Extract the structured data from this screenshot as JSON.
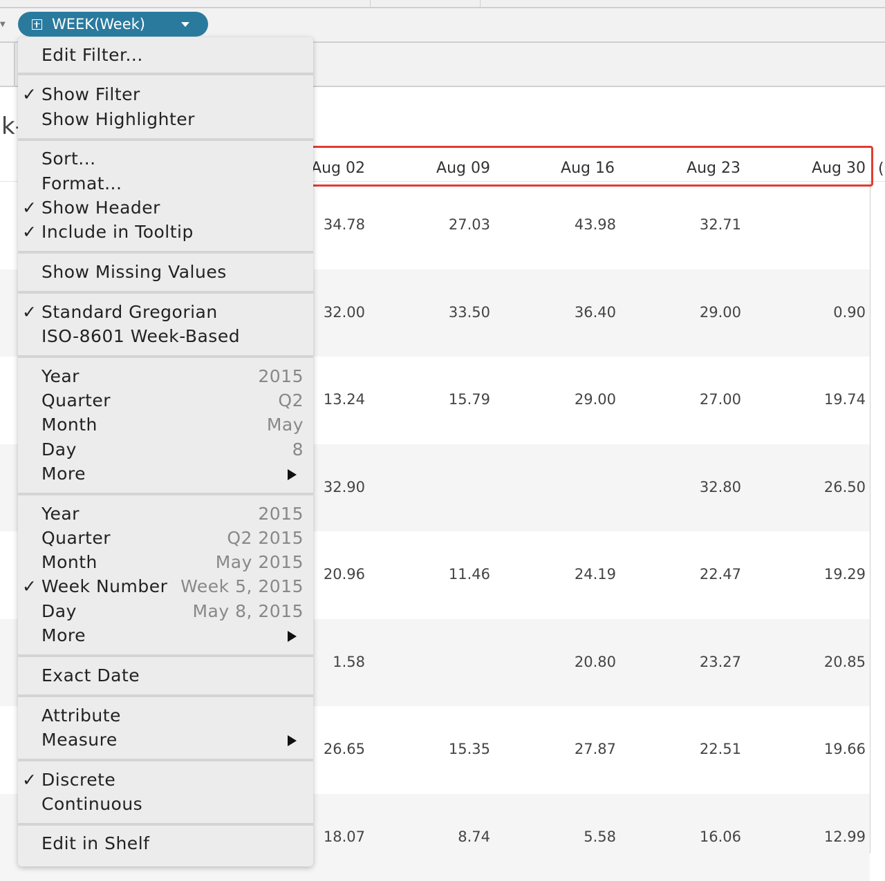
{
  "filter_pill": {
    "label": "WEEK(Week)",
    "icon": "plus-box-icon",
    "color": "#2a7a9e"
  },
  "sheet_title_fragment": "k-",
  "context_menu": {
    "edit_filter": "Edit Filter...",
    "show_filter": "Show Filter",
    "show_highlighter": "Show Highlighter",
    "sort": "Sort...",
    "format": "Format...",
    "show_header": "Show Header",
    "include_in_tooltip": "Include in Tooltip",
    "show_missing_values": "Show Missing Values",
    "standard_gregorian": "Standard Gregorian",
    "iso_week_based": "ISO-8601 Week-Based",
    "discrete_parts": [
      {
        "label": "Year",
        "value": "2015"
      },
      {
        "label": "Quarter",
        "value": "Q2"
      },
      {
        "label": "Month",
        "value": "May"
      },
      {
        "label": "Day",
        "value": "8"
      },
      {
        "label": "More",
        "value": ""
      }
    ],
    "continuous_parts": [
      {
        "label": "Year",
        "value": "2015"
      },
      {
        "label": "Quarter",
        "value": "Q2 2015"
      },
      {
        "label": "Month",
        "value": "May 2015"
      },
      {
        "label": "Week Number",
        "value": "Week 5, 2015"
      },
      {
        "label": "Day",
        "value": "May 8, 2015"
      },
      {
        "label": "More",
        "value": ""
      }
    ],
    "exact_date": "Exact Date",
    "attribute": "Attribute",
    "measure": "Measure",
    "discrete": "Discrete",
    "continuous": "Continuous",
    "edit_in_shelf": "Edit in Shelf",
    "checkmark": "✓",
    "accent_highlight": "#e03c31"
  },
  "table": {
    "columns": [
      "Aug 02",
      "Aug 09",
      "Aug 16",
      "Aug 23",
      "Aug 30"
    ],
    "rows": [
      [
        "34.78",
        "27.03",
        "43.98",
        "32.71",
        ""
      ],
      [
        "32.00",
        "33.50",
        "36.40",
        "29.00",
        "0.90"
      ],
      [
        "13.24",
        "15.79",
        "29.00",
        "27.00",
        "19.74"
      ],
      [
        "32.90",
        "",
        "",
        "32.80",
        "26.50"
      ],
      [
        "20.96",
        "11.46",
        "24.19",
        "22.47",
        "19.29"
      ],
      [
        "1.58",
        "",
        "20.80",
        "23.27",
        "20.85"
      ],
      [
        "26.65",
        "15.35",
        "27.87",
        "22.51",
        "19.66"
      ],
      [
        "18.07",
        "8.74",
        "5.58",
        "16.06",
        "12.99"
      ]
    ]
  }
}
